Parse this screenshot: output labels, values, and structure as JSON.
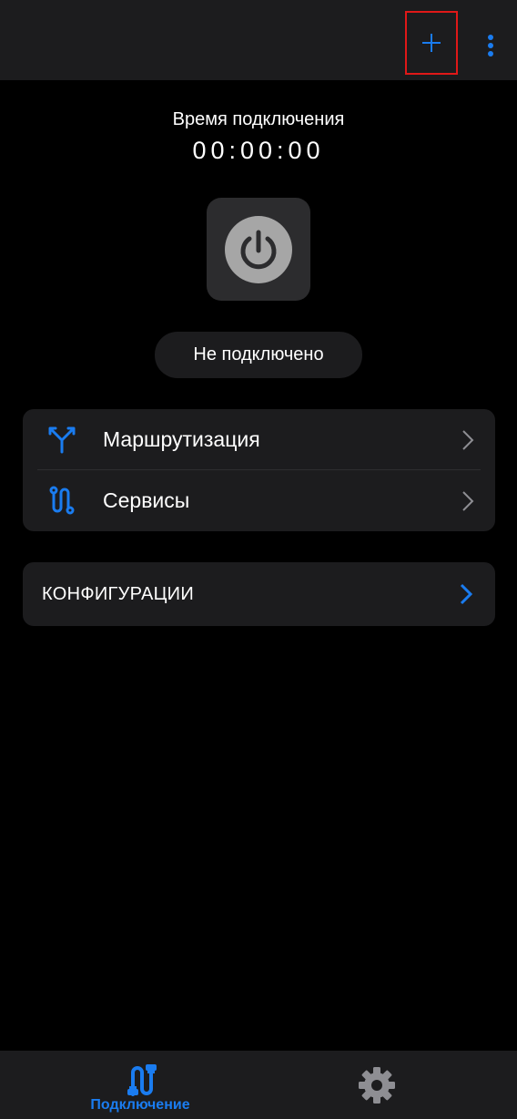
{
  "colors": {
    "accent": "#1a7cf0",
    "background": "#000000",
    "surface": "#1c1c1e",
    "power_card": "#2c2c2e",
    "power_circle": "#a6a6a6",
    "chevron_muted": "#8e8e93",
    "highlight_border": "#e01818"
  },
  "toolbar": {
    "add_icon": "plus-icon",
    "more_icon": "more-vertical-icon"
  },
  "timer": {
    "label": "Время подключения",
    "value": "00:00:00"
  },
  "power": {
    "icon": "power-icon"
  },
  "status": {
    "text": "Не подключено"
  },
  "menu": {
    "items": [
      {
        "label": "Маршрутизация",
        "icon": "routing-icon"
      },
      {
        "label": "Сервисы",
        "icon": "services-icon"
      }
    ]
  },
  "config": {
    "label": "КОНФИГУРАЦИИ"
  },
  "bottom_nav": {
    "tabs": [
      {
        "label": "Подключение",
        "icon": "connection-icon",
        "active": true
      },
      {
        "label": "",
        "icon": "gear-icon",
        "active": false
      }
    ]
  }
}
